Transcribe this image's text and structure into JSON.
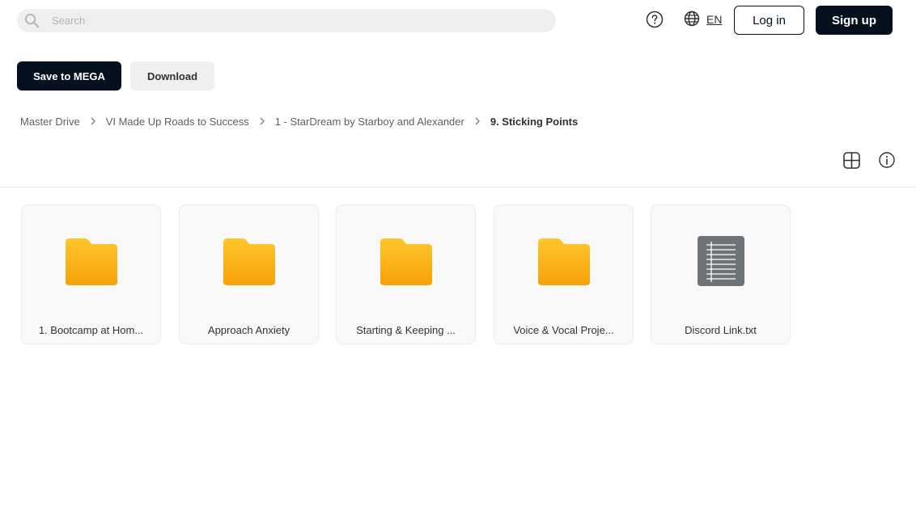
{
  "header": {
    "search_placeholder": "Search",
    "search_value": "",
    "language": "EN",
    "login_label": "Log in",
    "signup_label": "Sign up"
  },
  "actions": {
    "save_label": "Save to MEGA",
    "download_label": "Download"
  },
  "breadcrumb": [
    {
      "label": "Master Drive"
    },
    {
      "label": "VI Made Up Roads to Success"
    },
    {
      "label": "1 - StarDream by Starboy and Alexander"
    },
    {
      "label": "9. Sticking Points"
    }
  ],
  "items": [
    {
      "name": "1. Bootcamp at Hom...",
      "icon": "folder-icon"
    },
    {
      "name": "Approach Anxiety",
      "icon": "folder-icon"
    },
    {
      "name": "Starting & Keeping ...",
      "icon": "folder-icon"
    },
    {
      "name": "Voice & Vocal Proje...",
      "icon": "folder-icon"
    },
    {
      "name": "Discord Link.txt",
      "icon": "text-file-icon"
    }
  ],
  "colors": {
    "primary": "#04101e",
    "folder_top": "#ffc62c",
    "folder_bottom": "#f8a109",
    "file_icon": "#6e7378"
  }
}
